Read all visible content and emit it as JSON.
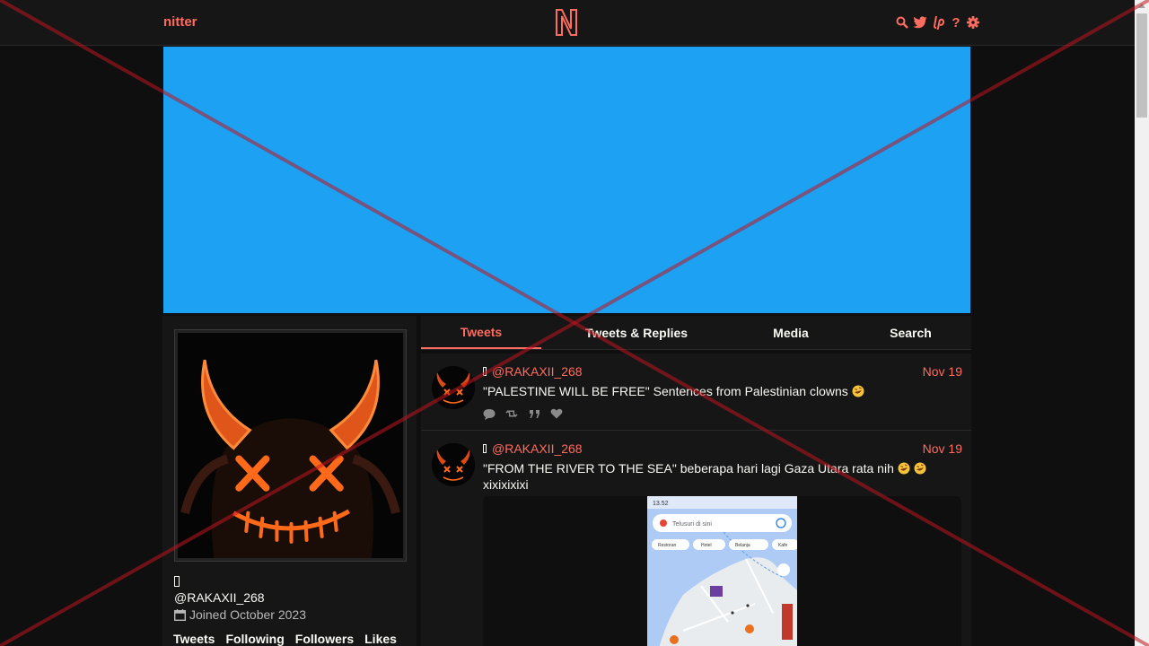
{
  "navbar": {
    "brand": "nitter",
    "icons": [
      "search-icon",
      "twitter-bird-icon",
      "liberapay-icon",
      "help-icon",
      "gear-icon"
    ],
    "help_glyph": "?"
  },
  "colors": {
    "accent": "#ff6c60",
    "banner": "#1da1f2",
    "background": "#0f0f0f",
    "panel": "#161616"
  },
  "profile": {
    "locked_glyph": "",
    "username": "@RAKAXII_268",
    "joined": "Joined October 2023",
    "stats": [
      "Tweets",
      "Following",
      "Followers",
      "Likes"
    ]
  },
  "tabs": [
    {
      "label": "Tweets",
      "active": true
    },
    {
      "label": "Tweets & Replies",
      "active": false
    },
    {
      "label": "Media",
      "active": false
    },
    {
      "label": "Search",
      "active": false
    }
  ],
  "tweets": [
    {
      "user": "@RAKAXII_268",
      "date": "Nov 19",
      "text": "\"PALESTINE WILL BE FREE\" Sentences from Palestinian clowns"
    },
    {
      "user": "@RAKAXII_268",
      "date": "Nov 19",
      "text": "\"FROM THE RIVER TO THE SEA\" beberapa hari lagi Gaza Utara rata nih",
      "text2": "xixixixixi",
      "media": {
        "status_time": "13.52",
        "search_placeholder": "Telusuri di sini",
        "chips": [
          "Restoran",
          "Hotel",
          "Belanja",
          "Kafe"
        ]
      }
    }
  ]
}
